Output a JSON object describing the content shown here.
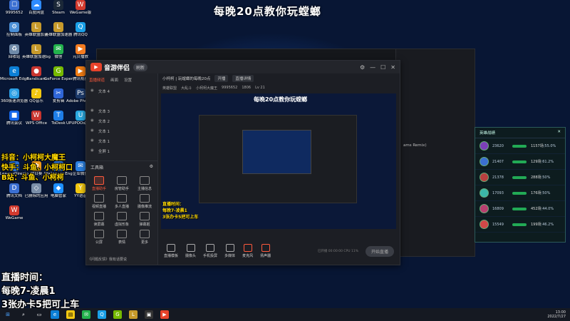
{
  "overlay_title": "每晚20点教你玩螳螂",
  "desktop_icons": [
    {
      "label": "9995652",
      "color": "#3b6fd1",
      "glyph": "☐"
    },
    {
      "label": "百度网盘",
      "color": "#2e8bff",
      "glyph": "☁"
    },
    {
      "label": "Steam",
      "color": "#1b2838",
      "glyph": "S"
    },
    {
      "label": "WeGame版",
      "color": "#d23a2e",
      "glyph": "W"
    },
    {
      "label": "控制面板",
      "color": "#4a8fd6",
      "glyph": "⚙"
    },
    {
      "label": "英雄联盟加速",
      "color": "#c79a2b",
      "glyph": "L"
    },
    {
      "label": "英雄联盟加速器",
      "color": "#c79a2b",
      "glyph": "L"
    },
    {
      "label": "腾讯QQ",
      "color": "#1aa0e8",
      "glyph": "Q"
    },
    {
      "label": "回收站",
      "color": "#6f8aa8",
      "glyph": "♻"
    },
    {
      "label": "英雄联盟加速bgm",
      "color": "#c79a2b",
      "glyph": "L"
    },
    {
      "label": "微信",
      "color": "#22b14c",
      "glyph": "✉"
    },
    {
      "label": "元贝播放",
      "color": "#f47b20",
      "glyph": "▶"
    },
    {
      "label": "Microsoft Edge",
      "color": "#0c7fd6",
      "glyph": "e"
    },
    {
      "label": "Bandicam",
      "color": "#c8352f",
      "glyph": "●"
    },
    {
      "label": "GeForce Experience",
      "color": "#76b900",
      "glyph": "G"
    },
    {
      "label": "腾讯视频",
      "color": "#f07c13",
      "glyph": "▶"
    },
    {
      "label": "360极速浏览器",
      "color": "#2c9fe4",
      "glyph": "◎"
    },
    {
      "label": "QQ音乐",
      "color": "#f2c811",
      "glyph": "♪"
    },
    {
      "label": "爱剪辑",
      "color": "#2f66d8",
      "glyph": "✂"
    },
    {
      "label": "Adobe Photoshop",
      "color": "#1c3a6b",
      "glyph": "Ps"
    },
    {
      "label": "腾讯会议",
      "color": "#1667e8",
      "glyph": "■"
    },
    {
      "label": "WPS Office",
      "color": "#c8352f",
      "glyph": "W"
    },
    {
      "label": "ToDesk",
      "color": "#1e7ee8",
      "glyph": "T"
    },
    {
      "label": "UPUPOO动态桌面",
      "color": "#2aa9e0",
      "glyph": "U"
    },
    {
      "label": "LeagueDirector",
      "color": "#2a6fd1",
      "glyph": "L"
    },
    {
      "label": "向日葵",
      "color": "#f09a1a",
      "glyph": "✿"
    },
    {
      "label": "Wallpaper Engine",
      "color": "#2a6fd1",
      "glyph": "W"
    },
    {
      "label": "企业微信",
      "color": "#2a7fe0",
      "glyph": "✉"
    },
    {
      "label": "腾讯文档",
      "color": "#3b6fd1",
      "glyph": "D"
    },
    {
      "label": "已删除的应用",
      "color": "#7b8fa8",
      "glyph": "◇"
    },
    {
      "label": "电脑管家",
      "color": "#1e90ff",
      "glyph": "◆"
    },
    {
      "label": "YY语音",
      "color": "#f2c811",
      "glyph": "Y"
    },
    {
      "label": "WeGame",
      "color": "#d23a2e",
      "glyph": "W"
    }
  ],
  "streamer_top": [
    "抖音：小柯柯大魔王",
    "快手：斗鱼、小柯柯口",
    "B站：斗鱼、小柯柯"
  ],
  "streamer_bottom": [
    "直播时间：",
    "每晚7-凌晨1",
    "3张办卡5把可上车"
  ],
  "app": {
    "name": "音游伴侣",
    "tag": "刷新",
    "left_tabs": [
      "直播频道",
      "画面",
      "设置"
    ],
    "layers": [
      "文本 4",
      "文本 3",
      "文本 2",
      "文本 1",
      "文本 1",
      "全屏 1"
    ],
    "tools_title": "工具箱",
    "tools": [
      "直播助手",
      "房管助手",
      "主播信息",
      "视频直播",
      "多人直播",
      "摄像推流",
      "读屏幕",
      "虚拟形象",
      "弹幕姬",
      "公屏",
      "表情",
      "更多"
    ],
    "notice": "《问题反馈》我有话要说",
    "topbar": [
      "小柯柯 | 玩螳螂的每晚20点",
      "开播",
      "直播详情"
    ],
    "subbar": [
      "英雄联盟",
      "大乱斗",
      "小柯柯大魔王",
      "9995652",
      "1806",
      "Lv 21"
    ],
    "preview_title": "每晚20点教你玩螳螂",
    "mini_streamer": [
      "直播时间：",
      "每晚7-凌晨1",
      "3张办卡5把可上车"
    ],
    "bottom_buttons": [
      "直播模板",
      "摄像头",
      "手机投屏",
      "多媒体",
      "麦克风",
      "扬声器"
    ],
    "status": "已开播 00:00:00 CPU 11%",
    "golive_label": "开始直播"
  },
  "bgwin_texts": [
    "ams Remix)"
  ],
  "game_panel": {
    "title": "英雄战绩",
    "rows": [
      {
        "val": "23620",
        "games": "1157场",
        "rate": "55.0%",
        "color": "#7b3fb8"
      },
      {
        "val": "21407",
        "games": "129场",
        "rate": "61.2%",
        "color": "#3b6fd1"
      },
      {
        "val": "21378",
        "games": "288场",
        "rate": "50%",
        "color": "#b83f3f"
      },
      {
        "val": "17093",
        "games": "176场",
        "rate": "50%",
        "color": "#3bb8a8"
      },
      {
        "val": "16809",
        "games": "452场",
        "rate": "44.0%",
        "color": "#b83f6f"
      },
      {
        "val": "15549",
        "games": "199场",
        "rate": "46.2%",
        "color": "#d04848"
      }
    ]
  },
  "taskbar": {
    "clock_time": "13:00",
    "clock_date": "2022/7/27"
  }
}
